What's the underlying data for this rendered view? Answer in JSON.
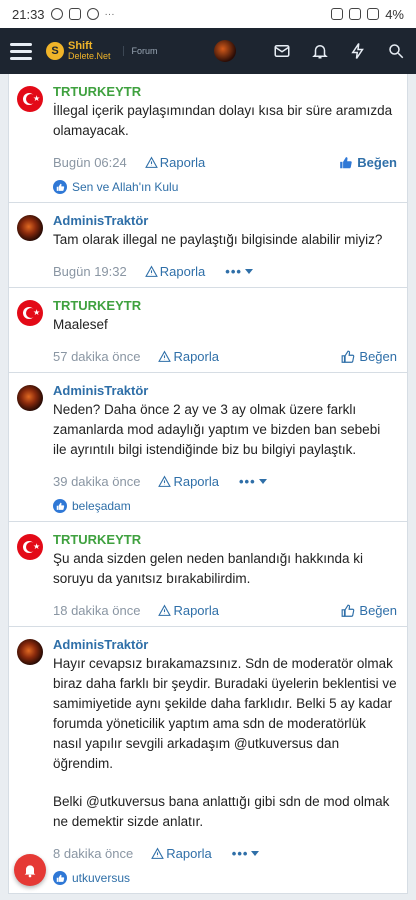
{
  "status_bar": {
    "time": "21:33",
    "battery": "4%",
    "more": "···"
  },
  "header": {
    "brand_line1": "Shift",
    "brand_line2": "Delete.Net",
    "section": "Forum"
  },
  "posts": [
    {
      "author": "TRTURKEYTR",
      "author_color": "green",
      "paragraphs": [
        "İllegal içerik paylaşımından dolayı kısa bir süre aramızda olamayacak."
      ],
      "time": "Bugün 06:24",
      "report": "Raporla",
      "like": "Beğen",
      "like_active": true,
      "reactions": "Sen ve Allah'ın Kulu"
    },
    {
      "author": "AdminisTraktör",
      "author_color": "blue",
      "paragraphs": [
        "Tam olarak illegal ne paylaştığı bilgisinde alabilir miyiz?"
      ],
      "time": "Bugün 19:32",
      "report": "Raporla",
      "more": "•••"
    },
    {
      "author": "TRTURKEYTR",
      "author_color": "green",
      "paragraphs": [
        "Maalesef"
      ],
      "time": "57 dakika önce",
      "report": "Raporla",
      "like": "Beğen",
      "like_active": false
    },
    {
      "author": "AdminisTraktör",
      "author_color": "blue",
      "paragraphs": [
        "Neden? Daha önce 2 ay ve 3 ay olmak üzere farklı zamanlarda mod adaylığı yaptım ve bizden ban sebebi ile ayrıntılı bilgi istendiğinde biz bu bilgiyi paylaştık."
      ],
      "time": "39 dakika önce",
      "report": "Raporla",
      "more": "•••",
      "reactions": "beleşadam"
    },
    {
      "author": "TRTURKEYTR",
      "author_color": "green",
      "paragraphs": [
        "Şu anda sizden gelen neden banlandığı hakkında ki soruyu da yanıtsız bırakabilirdim."
      ],
      "time": "18 dakika önce",
      "report": "Raporla",
      "like": "Beğen",
      "like_active": false
    },
    {
      "author": "AdminisTraktör",
      "author_color": "blue",
      "paragraphs": [
        "Hayır cevapsız bırakamazsınız. Sdn de moderatör olmak biraz daha farklı bir şeydir. Buradaki üyelerin beklentisi ve samimiyetide aynı şekilde daha farklıdır. Belki 5 ay kadar forumda yöneticilik yaptım ama sdn de moderatörlük nasıl yapılır sevgili arkadaşım @utkuversus dan öğrendim.",
        "Belki @utkuversus bana anlattığı gibi sdn de mod olmak ne demektir sizde anlatır."
      ],
      "time": "8 dakika önce",
      "report": "Raporla",
      "more": "•••",
      "reactions": "utkuversus"
    }
  ]
}
